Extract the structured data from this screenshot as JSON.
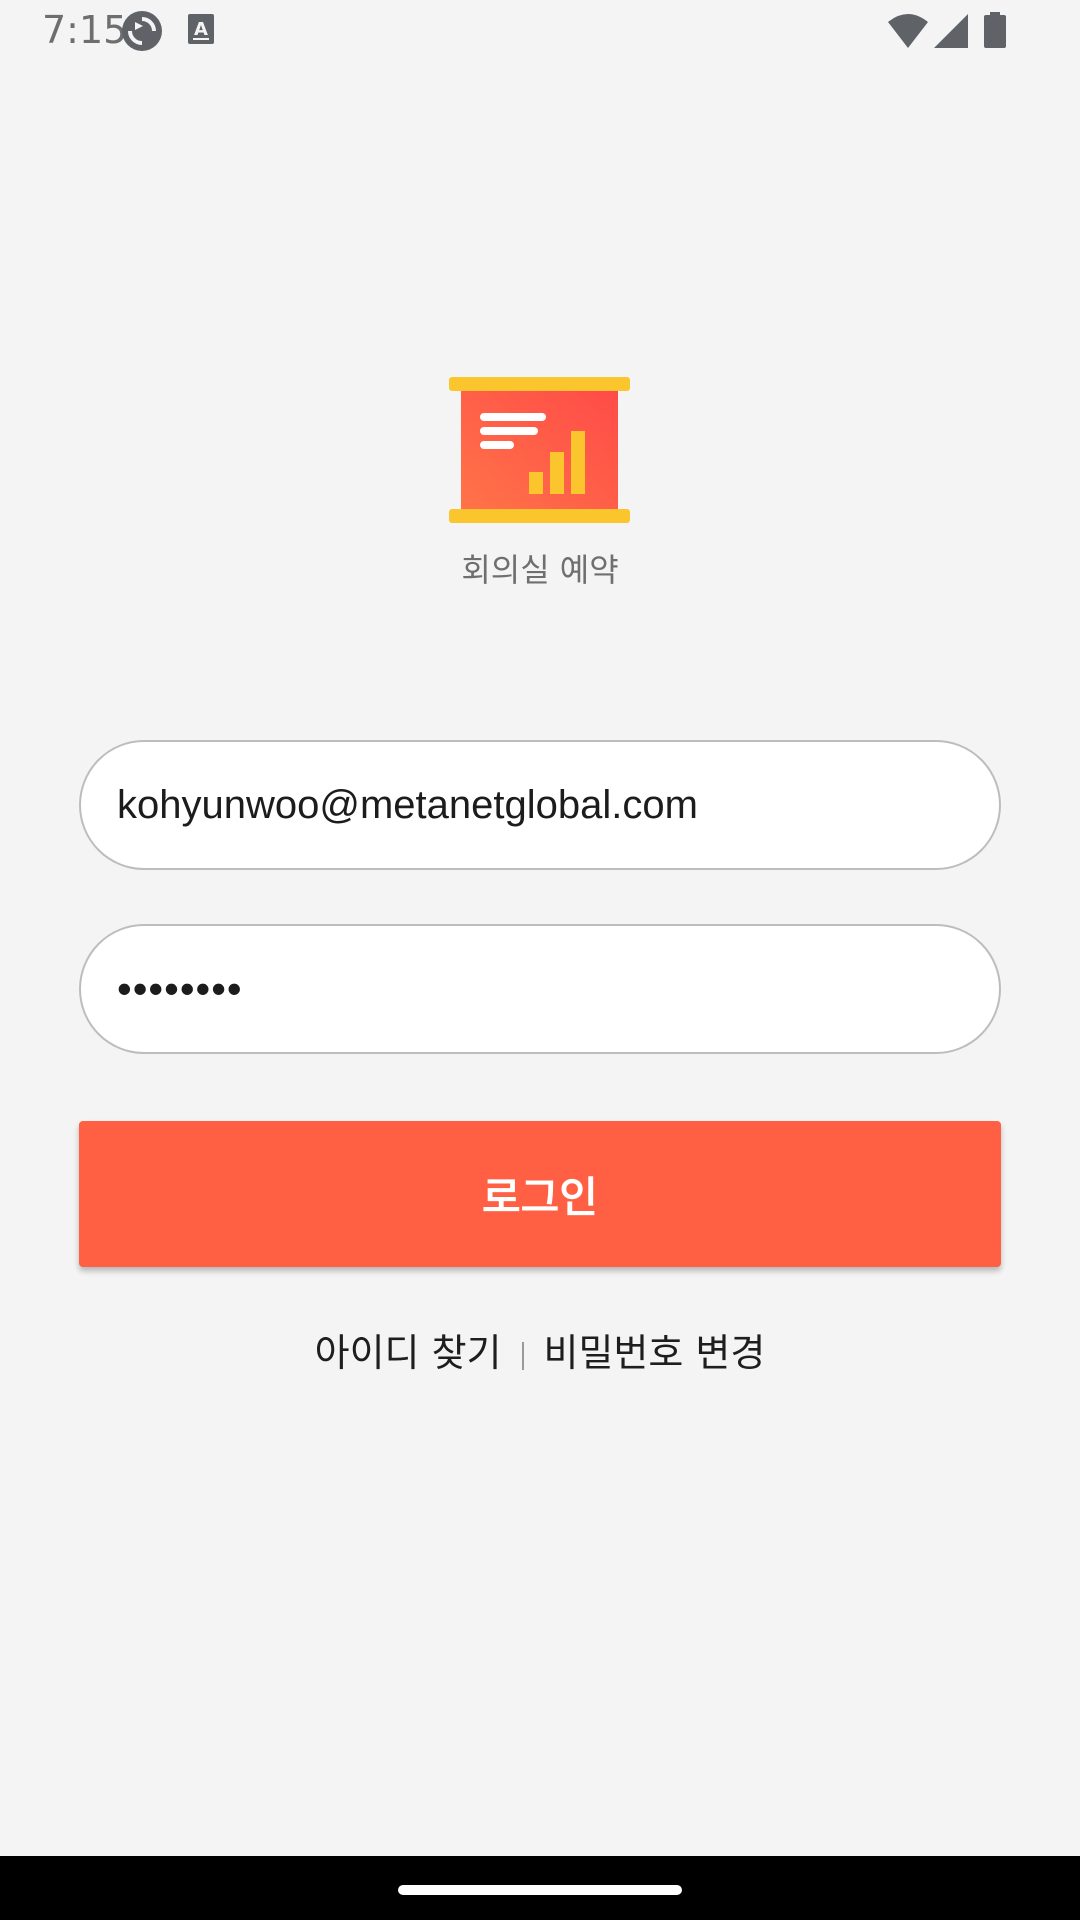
{
  "status_bar": {
    "time": "7:15",
    "icons": [
      "sync-icon",
      "text-a-icon",
      "wifi-icon",
      "signal-icon",
      "battery-icon"
    ]
  },
  "app": {
    "logo_icon": "presentation-chart-icon",
    "name": "회의실 예약"
  },
  "login_form": {
    "email_value": "kohyunwoo@metanetglobal.com",
    "password_value": "••••••••",
    "login_label": "로그인"
  },
  "links": {
    "find_id": "아이디 찾기",
    "change_password": "비밀번호 변경"
  },
  "colors": {
    "accent": "#ff6043",
    "background": "#f4f4f4",
    "logo_red": "#ff5044",
    "logo_yellow": "#fbc52d"
  }
}
